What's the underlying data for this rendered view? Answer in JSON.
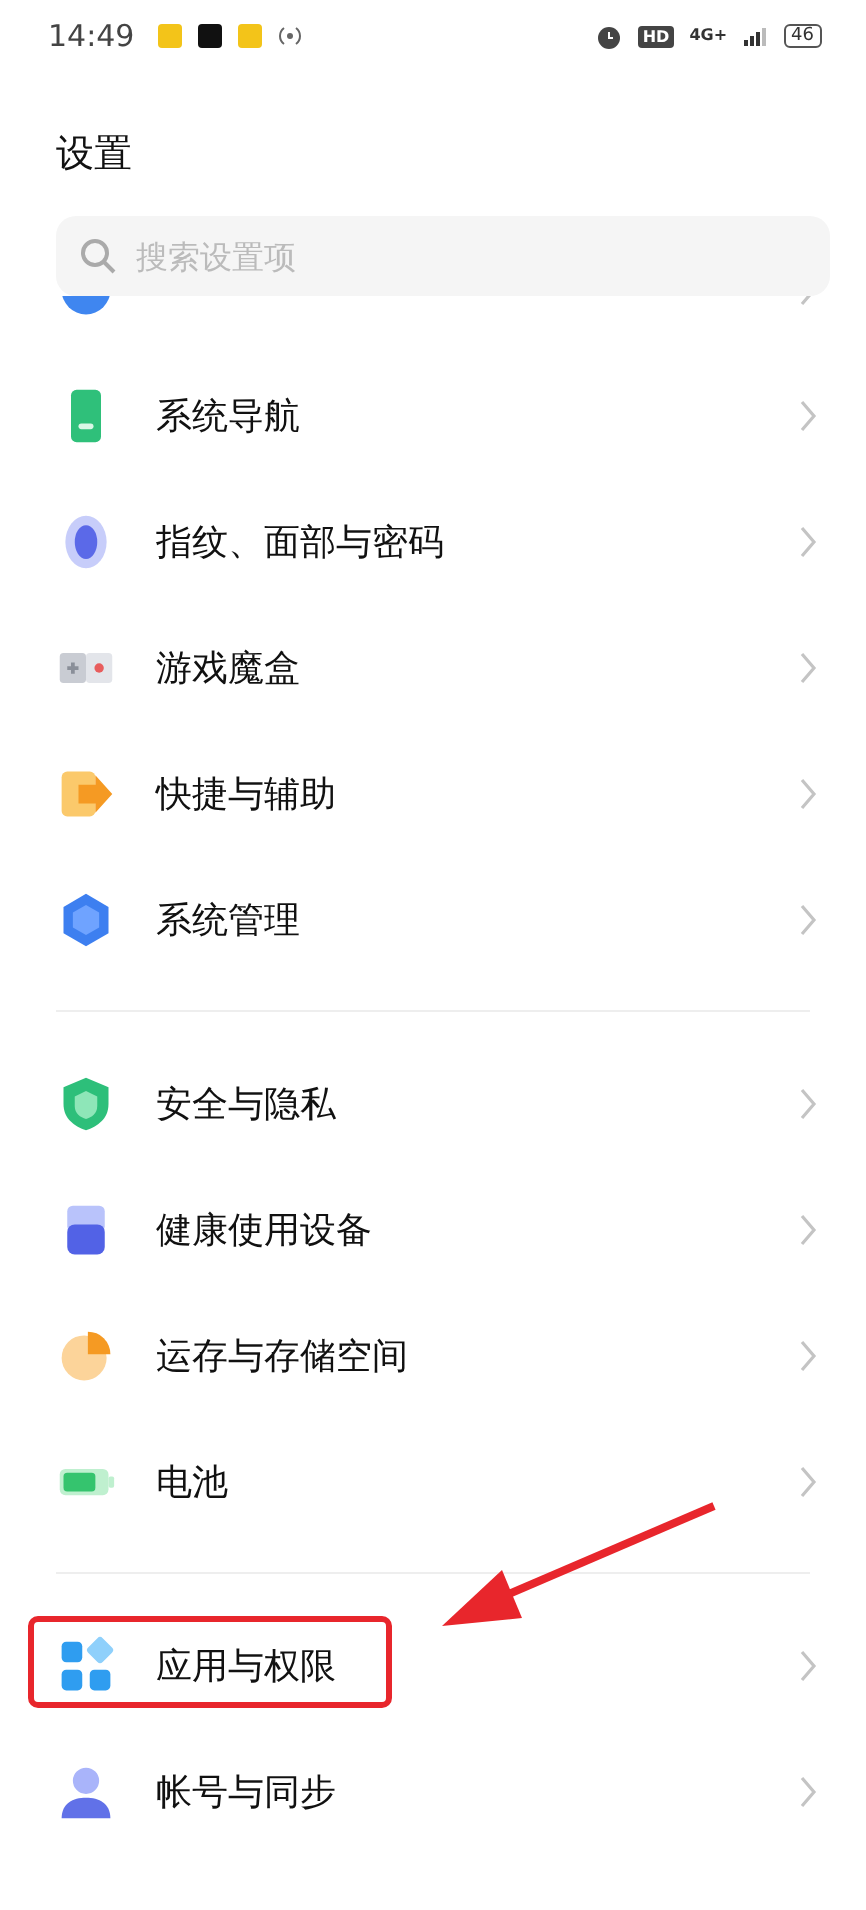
{
  "status_bar": {
    "time": "14:49",
    "network_badge": "HD",
    "network_type": "4G+",
    "battery": "46"
  },
  "title": "设置",
  "search": {
    "placeholder": "搜索设置项"
  },
  "groups": [
    {
      "items": [
        {
          "kind": "orb",
          "marked": false
        },
        {
          "label": "系统导航",
          "kind": "phone",
          "marked": false
        },
        {
          "label": "指纹、面部与密码",
          "kind": "fingerprint",
          "marked": false
        },
        {
          "label": "游戏魔盒",
          "kind": "gamepad",
          "marked": false
        },
        {
          "label": "快捷与辅助",
          "kind": "arrow",
          "marked": false
        },
        {
          "label": "系统管理",
          "kind": "hexagon",
          "marked": false
        }
      ]
    },
    {
      "items": [
        {
          "label": "安全与隐私",
          "kind": "shield",
          "marked": false
        },
        {
          "label": "健康使用设备",
          "kind": "device",
          "marked": false
        },
        {
          "label": "运存与存储空间",
          "kind": "pie",
          "marked": false
        },
        {
          "label": "电池",
          "kind": "battery",
          "marked": false
        }
      ]
    },
    {
      "items": [
        {
          "label": "应用与权限",
          "kind": "apps",
          "marked": true
        },
        {
          "label": "帐号与同步",
          "kind": "person",
          "marked": false
        }
      ]
    }
  ]
}
